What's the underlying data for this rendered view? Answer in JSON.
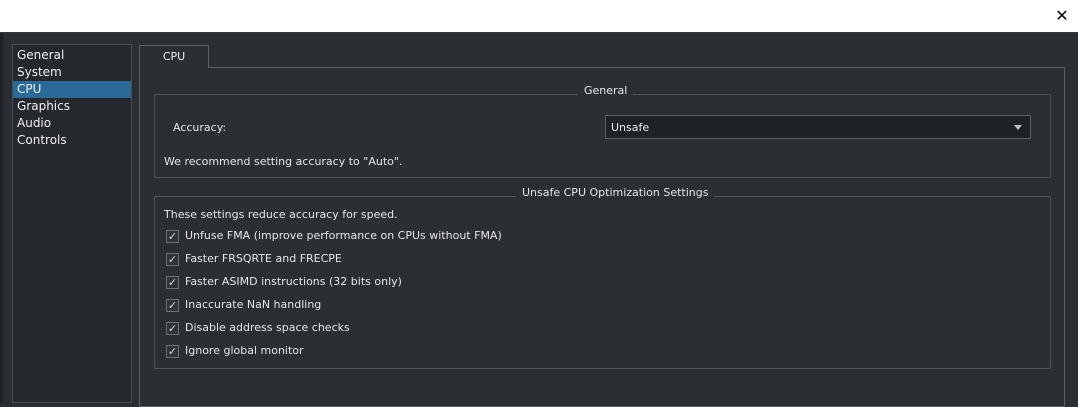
{
  "window": {
    "close_glyph": "✕"
  },
  "sidebar": {
    "items": [
      {
        "label": "General",
        "selected": false
      },
      {
        "label": "System",
        "selected": false
      },
      {
        "label": "CPU",
        "selected": true
      },
      {
        "label": "Graphics",
        "selected": false
      },
      {
        "label": "Audio",
        "selected": false
      },
      {
        "label": "Controls",
        "selected": false
      }
    ]
  },
  "tabs": {
    "active_label": "CPU"
  },
  "general_group": {
    "title": "General",
    "accuracy_label": "Accuracy:",
    "accuracy_value": "Unsafe",
    "recommendation": "We recommend setting accuracy to \"Auto\"."
  },
  "unsafe_group": {
    "title": "Unsafe CPU Optimization Settings",
    "description": "These settings reduce accuracy for speed.",
    "options": [
      {
        "label": "Unfuse FMA (improve performance on CPUs without FMA)",
        "checked": true
      },
      {
        "label": "Faster FRSQRTE and FRECPE",
        "checked": true
      },
      {
        "label": "Faster ASIMD instructions (32 bits only)",
        "checked": true
      },
      {
        "label": "Inaccurate NaN handling",
        "checked": true
      },
      {
        "label": "Disable address space checks",
        "checked": true
      },
      {
        "label": "Ignore global monitor",
        "checked": true
      }
    ]
  },
  "colors": {
    "background": "#2b2f33",
    "selection": "#2a6a97",
    "titlebar": "#ffffff"
  }
}
